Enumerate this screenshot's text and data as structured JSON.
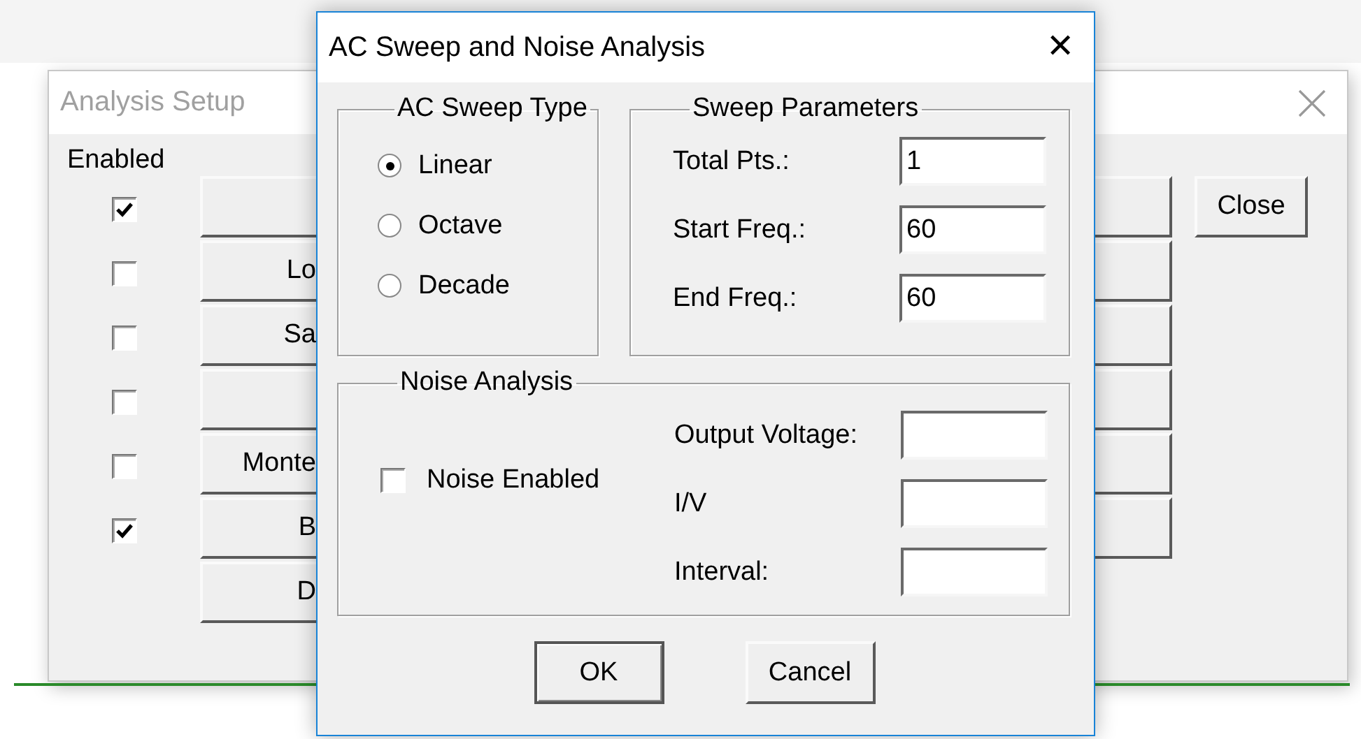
{
  "setup_window": {
    "title": "Analysis Setup",
    "enabled_heading": "Enabled",
    "checkboxes": [
      {
        "checked": true
      },
      {
        "checked": false
      },
      {
        "checked": false
      },
      {
        "checked": false
      },
      {
        "checked": false
      },
      {
        "checked": true
      }
    ],
    "buttons": [
      {
        "kind": "blank"
      },
      {
        "kind": "labelled",
        "label": "Lo"
      },
      {
        "kind": "labelled",
        "label": "Sa"
      },
      {
        "kind": "blank"
      },
      {
        "kind": "labelled",
        "label": "Monte"
      },
      {
        "kind": "labelled",
        "label": "B"
      },
      {
        "kind": "labelled",
        "label": "D"
      }
    ],
    "close_button": "Close"
  },
  "dialog": {
    "title": "AC Sweep and Noise Analysis",
    "close_glyph": "✕",
    "sweep_type": {
      "title": "AC Sweep Type",
      "options": [
        {
          "label": "Linear",
          "selected": true
        },
        {
          "label": "Octave",
          "selected": false
        },
        {
          "label": "Decade",
          "selected": false
        }
      ]
    },
    "sweep_parameters": {
      "title": "Sweep Parameters",
      "fields": [
        {
          "label": "Total Pts.:",
          "value": "1"
        },
        {
          "label": "Start Freq.:",
          "value": "60"
        },
        {
          "label": "End Freq.:",
          "value": "60"
        }
      ]
    },
    "noise": {
      "title": "Noise Analysis",
      "enabled_label": "Noise Enabled",
      "enabled": false,
      "fields": [
        {
          "label": "Output Voltage:"
        },
        {
          "label": "I/V"
        },
        {
          "label": "Interval:"
        }
      ]
    },
    "buttons": [
      "OK",
      "Cancel"
    ]
  }
}
